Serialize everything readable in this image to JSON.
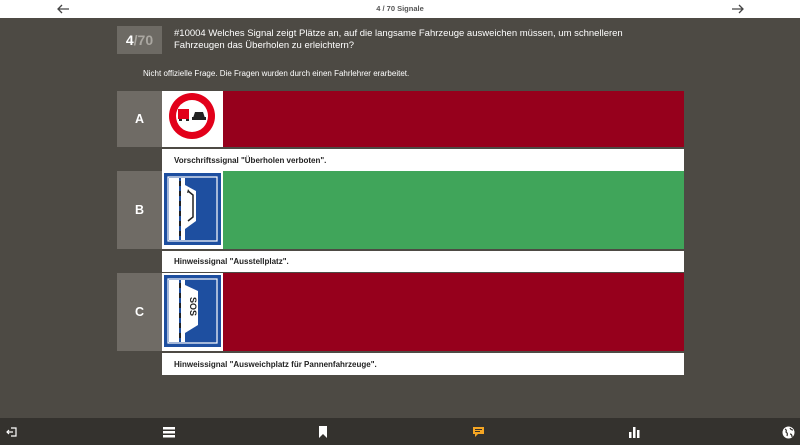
{
  "topbar": {
    "counter": "4 / 70 Signale",
    "prev_icon": "arrow-left-icon",
    "next_icon": "arrow-right-icon"
  },
  "question": {
    "number": "4",
    "total": "/70",
    "text": "#10004 Welches Signal zeigt Plätze an, auf die langsame Fahrzeuge ausweichen müssen, um schnelleren Fahrzeugen das Überholen zu erleichtern?",
    "disclaimer": "Nicht offizielle Frage. Die Fragen wurden durch einen Fahrlehrer erarbeitet."
  },
  "answers": [
    {
      "letter": "A",
      "caption": "Vorschriftssignal \"Überholen verboten\".",
      "state": "wrong",
      "sign": "no-overtaking-trucks-sign"
    },
    {
      "letter": "B",
      "caption": "Hinweissignal \"Ausstellplatz\".",
      "state": "correct",
      "sign": "lay-by-sign"
    },
    {
      "letter": "C",
      "caption": "Hinweissignal \"Ausweichplatz für Pannenfahrzeuge\".",
      "state": "wrong",
      "sign": "sos-lay-by-sign"
    }
  ],
  "sign_text": {
    "sos": "SOS"
  },
  "colors": {
    "wrong": "#96001c",
    "correct": "#40a55a",
    "letter_bg": "#6f6b65",
    "background": "#4d4a44",
    "bottombar": "#34322e",
    "highlight": "#f5a623"
  },
  "bottombar": {
    "icons": [
      "exit-icon",
      "list-icon",
      "bookmark-icon",
      "comment-icon",
      "stats-icon",
      "globe-icon"
    ],
    "active": "comment-icon"
  }
}
